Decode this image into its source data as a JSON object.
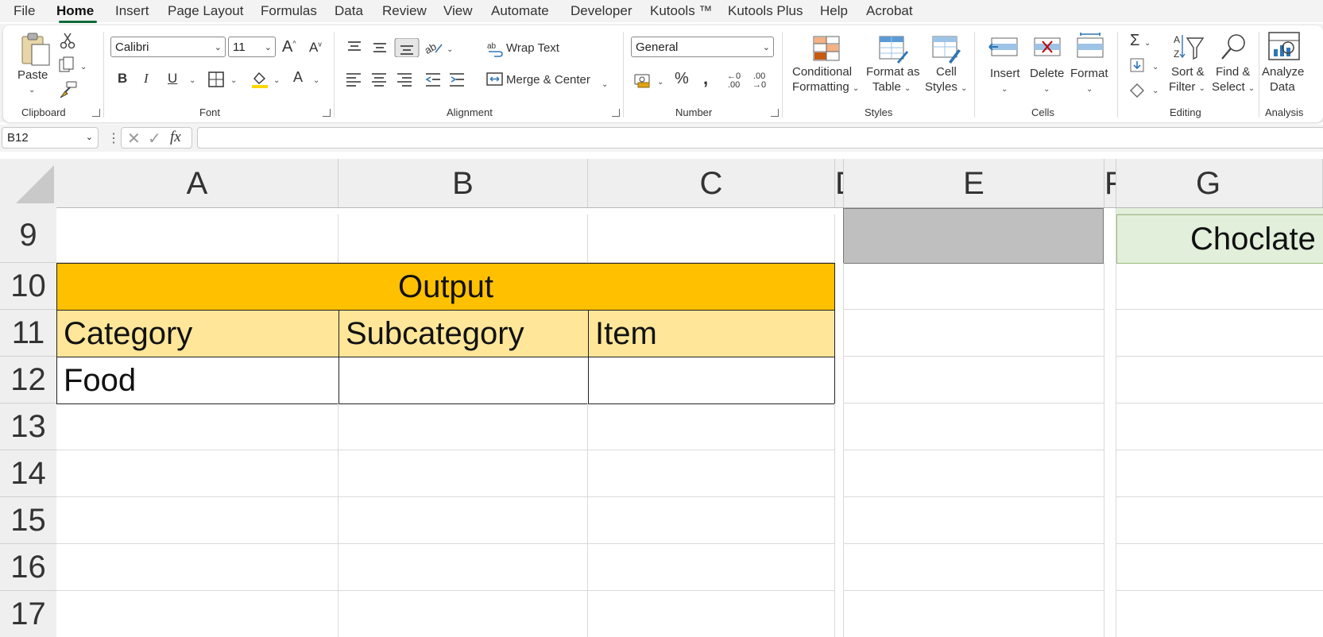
{
  "menu": [
    "File",
    "Home",
    "Insert",
    "Page Layout",
    "Formulas",
    "Data",
    "Review",
    "View",
    "Automate",
    "Developer",
    "Kutools ™",
    "Kutools Plus",
    "Help",
    "Acrobat"
  ],
  "ribbon": {
    "clipboard": {
      "paste": "Paste",
      "label": "Clipboard"
    },
    "font": {
      "name": "Calibri",
      "size": "11",
      "bold": "B",
      "italic": "I",
      "underline": "U",
      "font_color": "A",
      "grow": "A",
      "shrink": "A",
      "label": "Font"
    },
    "alignment": {
      "wrap": "Wrap Text",
      "merge": "Merge & Center",
      "label": "Alignment"
    },
    "number": {
      "format": "General",
      "percent": "%",
      "comma": "̹",
      "inc_decimal": "←.0 .00",
      "dec_decimal": ".00 →.0",
      "label": "Number"
    },
    "styles": {
      "cond_line1": "Conditional",
      "cond_line2": "Formatting",
      "table_line1": "Format as",
      "table_line2": "Table",
      "cell_line1": "Cell",
      "cell_line2": "Styles",
      "label": "Styles"
    },
    "cells": {
      "insert": "Insert",
      "delete": "Delete",
      "format": "Format",
      "label": "Cells"
    },
    "editing": {
      "sum": "Σ",
      "sort_line1": "Sort &",
      "sort_line2": "Filter",
      "find_line1": "Find &",
      "find_line2": "Select",
      "label": "Editing"
    },
    "analysis": {
      "line1": "Analyze",
      "line2": "Data",
      "label": "Analysis"
    }
  },
  "formula_bar": {
    "name_box": "B12",
    "fx": "fx",
    "value": ""
  },
  "columns": [
    "A",
    "B",
    "C",
    "D",
    "E",
    "F",
    "G"
  ],
  "rows": [
    "9",
    "10",
    "11",
    "12",
    "13",
    "14",
    "15",
    "16",
    "17"
  ],
  "cells": {
    "output_title": "Output",
    "h_category": "Category",
    "h_subcategory": "Subcategory",
    "h_item": "Item",
    "a12": "Food",
    "g9": "Choclate"
  },
  "colors": {
    "accent": "#0f6b3a",
    "output_fill": "#ffc000",
    "header_fill": "#ffe699",
    "gray_fill": "#bfbfbf",
    "green_fill": "#e2efda"
  }
}
